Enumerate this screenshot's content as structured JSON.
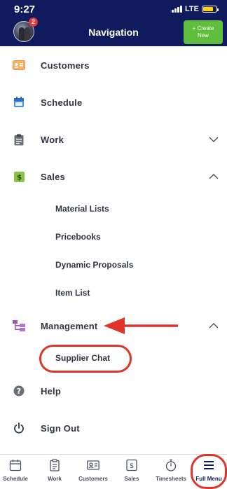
{
  "status_bar": {
    "time": "9:27",
    "network": "LTE"
  },
  "header": {
    "title": "Navigation",
    "badge_count": "2",
    "create_line1": "+ Create",
    "create_line2": "New"
  },
  "menu": {
    "customers": "Customers",
    "schedule": "Schedule",
    "work": "Work",
    "sales": "Sales",
    "sales_sub": [
      "Material Lists",
      "Pricebooks",
      "Dynamic Proposals",
      "Item List"
    ],
    "management": "Management",
    "management_sub": [
      "Supplier Chat"
    ],
    "help": "Help",
    "sign_out": "Sign Out"
  },
  "tabs": [
    {
      "label": "Schedule",
      "icon": "calendar-icon"
    },
    {
      "label": "Work",
      "icon": "clipboard-icon"
    },
    {
      "label": "Customers",
      "icon": "id-card-icon"
    },
    {
      "label": "Sales",
      "icon": "dollar-icon"
    },
    {
      "label": "Timesheets",
      "icon": "stopwatch-icon"
    },
    {
      "label": "Full Menu",
      "icon": "hamburger-icon"
    }
  ],
  "colors": {
    "header_bg": "#0f1b5c",
    "create_button": "#5fbe3b",
    "badge": "#e2373d",
    "annotation": "#e0342b",
    "battery": "#ffd21e"
  }
}
